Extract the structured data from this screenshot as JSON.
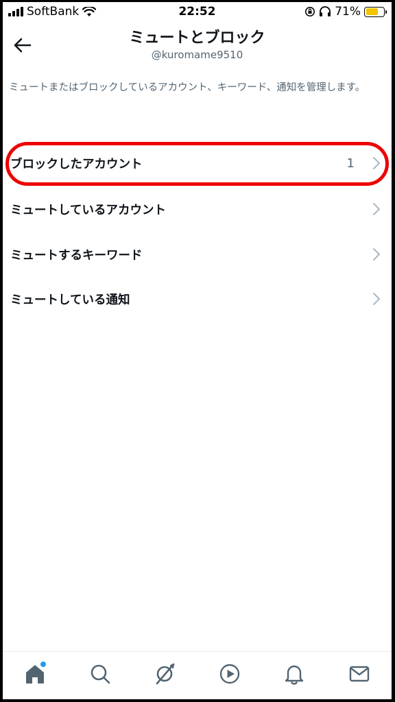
{
  "status_bar": {
    "carrier": "SoftBank",
    "time": "22:52",
    "battery_percent": "71%",
    "battery_level": 0.71,
    "battery_color": "#f4c400"
  },
  "header": {
    "back_icon": "arrow-left-icon",
    "title": "ミュートとブロック",
    "username": "@kuromame9510"
  },
  "description": "ミュートまたはブロックしているアカウント、キーワード、通知を管理します。",
  "menu": {
    "items": [
      {
        "label": "ブロックしたアカウント",
        "count": "1",
        "highlighted": true
      },
      {
        "label": "ミュートしているアカウント",
        "count": ""
      },
      {
        "label": "ミュートするキーワード",
        "count": ""
      },
      {
        "label": "ミュートしている通知",
        "count": ""
      }
    ],
    "highlight_color": "#ee0000"
  },
  "tab_bar": {
    "tabs": [
      "home-icon",
      "search-icon",
      "spaces-icon",
      "video-icon",
      "notifications-icon",
      "messages-icon"
    ],
    "home_has_dot": true,
    "dot_color": "#1d9bf0"
  }
}
